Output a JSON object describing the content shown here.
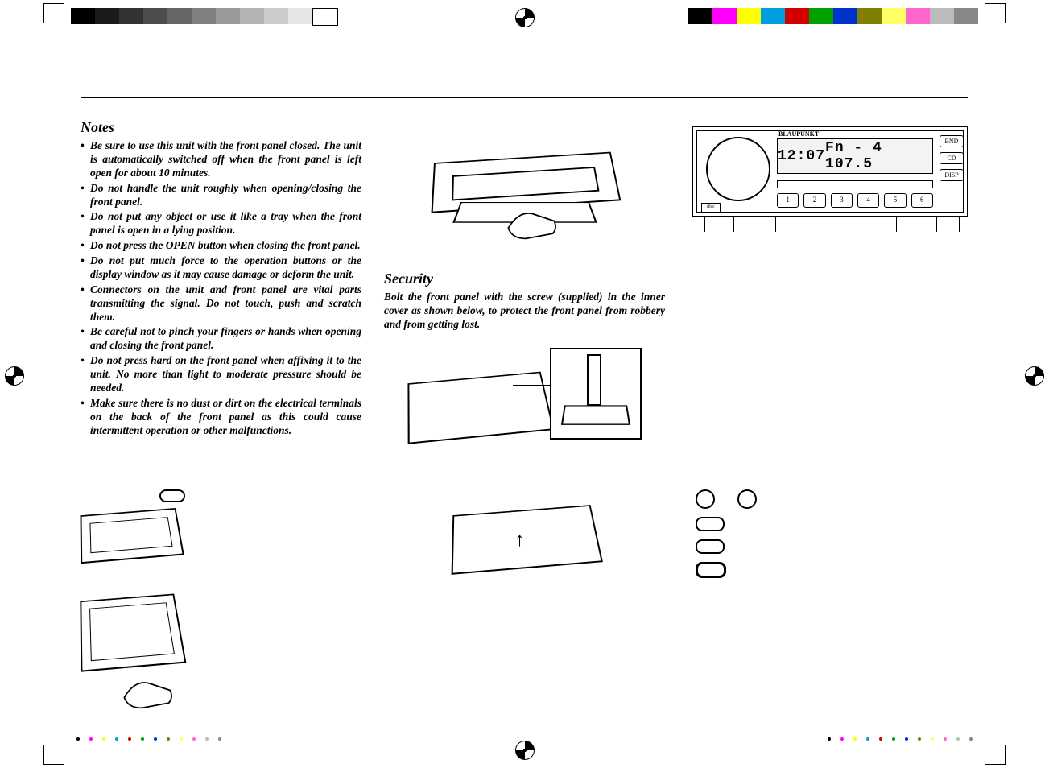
{
  "notes": {
    "heading": "Notes",
    "items": [
      "Be sure to use this unit with the front panel closed. The unit is automatically switched off when the front panel is left open for about 10 minutes.",
      "Do not handle the unit roughly when opening/closing the front panel.",
      "Do not put any object or use it like a tray when the front panel is open in a lying position.",
      "Do not press the OPEN button when closing the front panel.",
      "Do not put much force to the operation buttons or the display window as it may cause damage or deform the unit.",
      "Connectors on the unit and front panel are vital parts transmitting the signal. Do not touch, push and scratch them.",
      "Be careful not to pinch your fingers or hands when opening and closing the front panel.",
      "Do not press hard on the front panel when affixing it to the unit. No more than light to moderate pressure should be needed.",
      "Make sure there is no dust or dirt on the electrical terminals on the back of the front panel as this could cause intermittent operation or other malfunctions."
    ]
  },
  "security": {
    "heading": "Security",
    "text": "Bolt the front panel with the screw (supplied) in the inner cover as shown below, to protect the front panel from robbery and from getting lost."
  },
  "radio": {
    "brand": "BLAUPUNKT",
    "clock": "12:07",
    "line": "Fn - 4   107.5",
    "presets": [
      "1",
      "2",
      "3",
      "4",
      "5",
      "6"
    ],
    "side_buttons": [
      "BND",
      "CD",
      "DISP"
    ],
    "disc_logo": "disc"
  },
  "print_marks": {
    "greyscale_steps": 11,
    "colour_swatches": [
      "#000000",
      "#ff00ff",
      "#ffff00",
      "#00a0e0",
      "#d00000",
      "#00a000",
      "#0033cc",
      "#808000",
      "#ffff66",
      "#ff66cc",
      "#bbbbbb",
      "#888888"
    ]
  }
}
